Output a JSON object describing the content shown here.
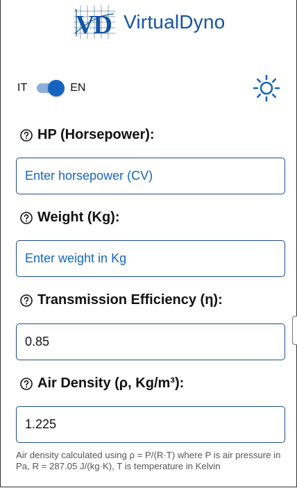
{
  "app": {
    "logo_mark": "VD",
    "name": "VirtualDyno",
    "brand_color": "#1354a4",
    "accent_color": "#1565c0"
  },
  "language": {
    "left": "IT",
    "right": "EN",
    "selected": "EN"
  },
  "theme_toggle": {
    "icon": "sun-icon"
  },
  "fields": [
    {
      "label": "HP (Horsepower):",
      "value": "",
      "placeholder": "Enter horsepower (CV)",
      "help_icon": "help-circle-icon"
    },
    {
      "label": "Weight (Kg):",
      "value": "",
      "placeholder": "Enter weight in Kg",
      "help_icon": "help-circle-icon"
    },
    {
      "label": "Transmission Efficiency (η):",
      "value": "0.85",
      "placeholder": "",
      "help_icon": "help-circle-icon"
    },
    {
      "label": "Air Density (ρ, Kg/m³):",
      "value": "1.225",
      "placeholder": "",
      "help_icon": "help-circle-icon"
    }
  ],
  "air_density_hint": "Air density calculated using ρ = P/(R·T) where P is air pressure in Pa, R = 287.05 J/(kg·K), T is temperature in Kelvin"
}
